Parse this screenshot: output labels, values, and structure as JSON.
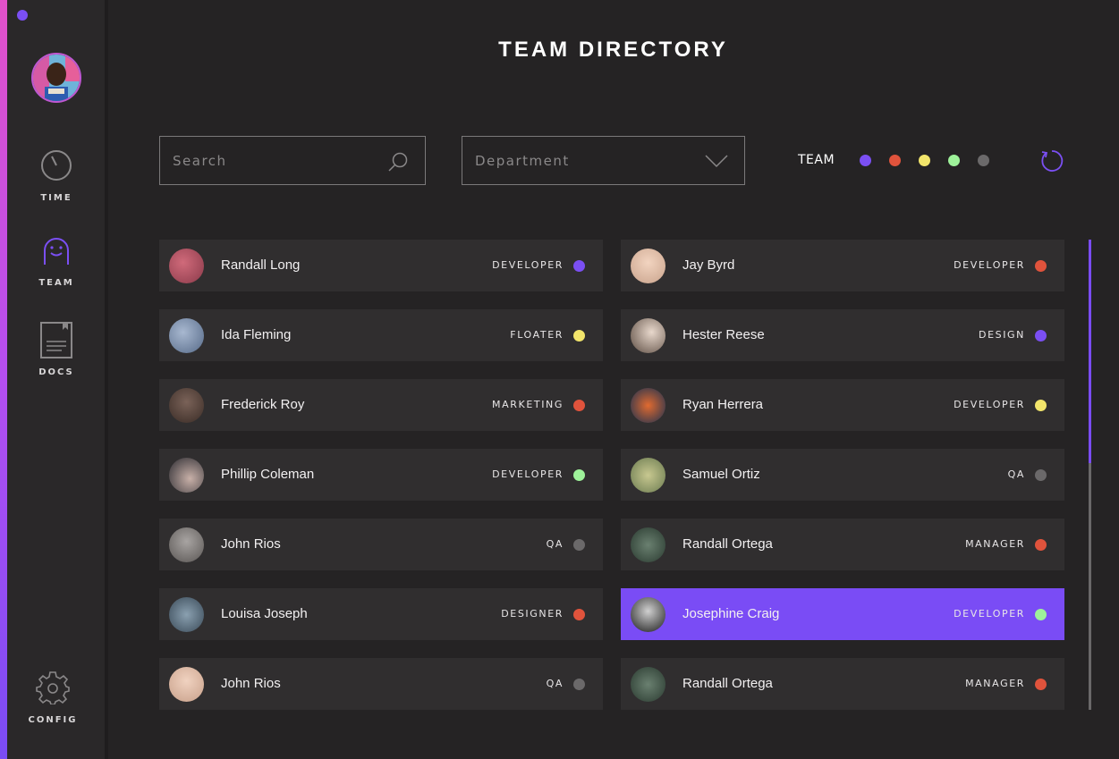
{
  "app": {
    "title": "TEAM DIRECTORY",
    "accent_color": "#7a4cf5"
  },
  "sidebar": {
    "items": [
      {
        "label": "TIME",
        "icon": "stopwatch-icon"
      },
      {
        "label": "TEAM",
        "icon": "smiley-person-icon",
        "active": true
      },
      {
        "label": "DOCS",
        "icon": "document-icon"
      },
      {
        "label": "CONFIG",
        "icon": "gear-icon"
      }
    ]
  },
  "search": {
    "placeholder": "Search",
    "value": ""
  },
  "department": {
    "placeholder": "Department"
  },
  "team_filter": {
    "label": "TEAM",
    "colors": [
      "#7b4ff3",
      "#e0533c",
      "#f2e56b",
      "#9ef29a",
      "#6b696a"
    ]
  },
  "status_colors": {
    "purple": "#7b4ff3",
    "red": "#e0533c",
    "yellow": "#f2e56b",
    "green": "#9ef29a",
    "gray": "#6b696a"
  },
  "members": [
    {
      "name": "Randall Long",
      "role": "DEVELOPER",
      "dot": "#7b4ff3",
      "avatar": "radial-gradient(circle at 40% 40%, #d06a7a, #8a3a4a)"
    },
    {
      "name": "Jay Byrd",
      "role": "DEVELOPER",
      "dot": "#e0533c",
      "avatar": "radial-gradient(circle at 50% 40%, #f2d4c0, #c9a38c)"
    },
    {
      "name": "Ida Fleming",
      "role": "FLOATER",
      "dot": "#f2e56b",
      "avatar": "radial-gradient(circle at 40% 40%, #a8b8d0, #566a88)"
    },
    {
      "name": "Hester Reese",
      "role": "DESIGN",
      "dot": "#7b4ff3",
      "avatar": "radial-gradient(circle at 60% 40%, #e8d8cc, #5a4a40)"
    },
    {
      "name": "Frederick Roy",
      "role": "MARKETING",
      "dot": "#e0533c",
      "avatar": "radial-gradient(circle at 50% 40%, #7a6258, #3a2c26)"
    },
    {
      "name": "Ryan Herrera",
      "role": "DEVELOPER",
      "dot": "#f2e56b",
      "avatar": "radial-gradient(circle at 50% 50%, #e06a30, #1a3050)"
    },
    {
      "name": "Phillip Coleman",
      "role": "DEVELOPER",
      "dot": "#9ef29a",
      "avatar": "radial-gradient(circle at 60% 60%, #c8b0a8, #2a2a30)"
    },
    {
      "name": "Samuel Ortiz",
      "role": "QA",
      "dot": "#6b696a",
      "avatar": "radial-gradient(circle at 50% 50%, #c8c890, #6a7a50)"
    },
    {
      "name": "John Rios",
      "role": "QA",
      "dot": "#6b696a",
      "avatar": "radial-gradient(circle at 50% 40%, #a8a4a2, #5a5654)"
    },
    {
      "name": "Randall Ortega",
      "role": "MANAGER",
      "dot": "#e0533c",
      "avatar": "radial-gradient(circle at 50% 50%, #6a8070, #2a3a30)"
    },
    {
      "name": "Louisa Joseph",
      "role": "DESIGNER",
      "dot": "#e0533c",
      "avatar": "radial-gradient(circle at 50% 50%, #8aa0b0, #3a4a58)"
    },
    {
      "name": "Josephine Craig",
      "role": "DEVELOPER",
      "dot": "#9ef29a",
      "avatar": "radial-gradient(circle at 50% 40%, #d0d0d0, #1a1a1a)",
      "selected": true
    },
    {
      "name": "John Rios",
      "role": "QA",
      "dot": "#6b696a",
      "avatar": "radial-gradient(circle at 50% 40%, #f0d2c0, #c8a08a)"
    },
    {
      "name": "Randall Ortega",
      "role": "MANAGER",
      "dot": "#e0533c",
      "avatar": "radial-gradient(circle at 50% 50%, #6a8070, #2a3a30)"
    }
  ],
  "scrollbar": {
    "position_fraction": 0.0,
    "visible_fraction": 0.48
  }
}
